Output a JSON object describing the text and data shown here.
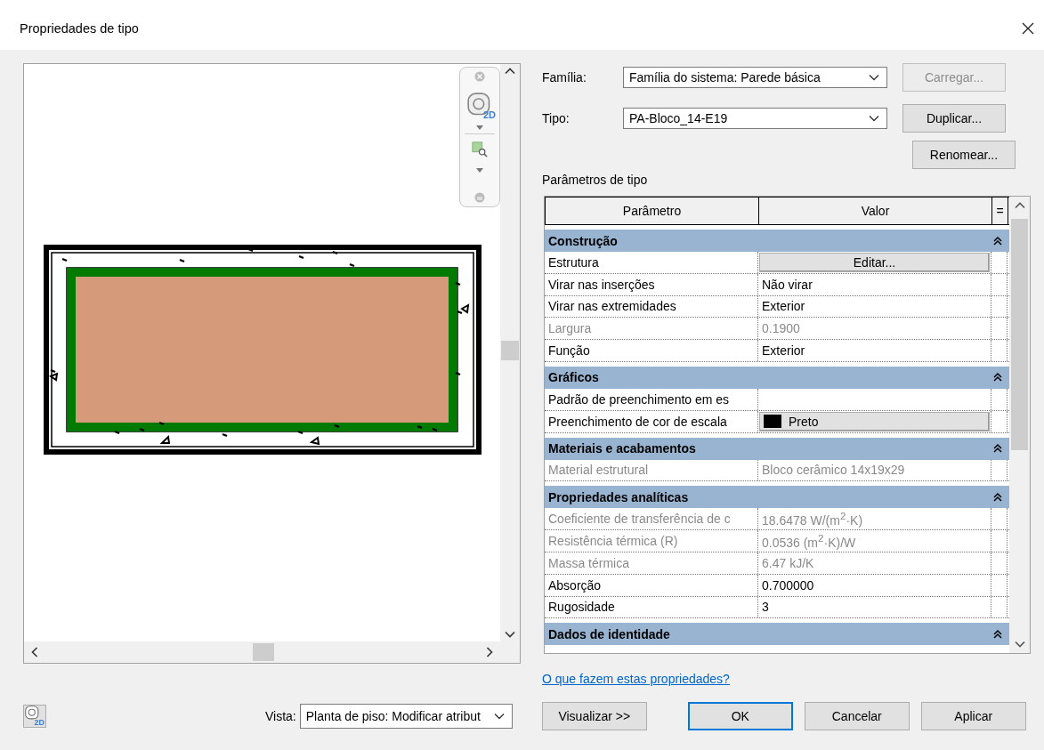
{
  "window": {
    "title": "Propriedades de tipo"
  },
  "navigation": {
    "wheel_badge": "2D"
  },
  "family": {
    "label": "Família:",
    "value": "Família do sistema: Parede básica"
  },
  "type": {
    "label": "Tipo:",
    "value": "PA-Bloco_14-E19"
  },
  "side_buttons": [
    {
      "label": "Carregar...",
      "disabled": true
    },
    {
      "label": "Duplicar...",
      "disabled": false
    },
    {
      "label": "Renomear...",
      "disabled": false
    }
  ],
  "parameters": {
    "title": "Parâmetros de tipo",
    "columns": [
      "Parâmetro",
      "Valor",
      "="
    ],
    "rows": [
      {
        "kind": "group",
        "label": "Construção",
        "expanded": true
      },
      {
        "kind": "button",
        "name": "Estrutura",
        "value": "Editar...",
        "disabled": false
      },
      {
        "kind": "text",
        "name": "Virar nas inserções",
        "value": "Não virar",
        "disabled": false
      },
      {
        "kind": "text",
        "name": "Virar nas extremidades",
        "value": "Exterior",
        "disabled": false
      },
      {
        "kind": "text",
        "name": "Largura",
        "value": "0.1900",
        "disabled": true
      },
      {
        "kind": "text",
        "name": "Função",
        "value": "Exterior",
        "disabled": false
      },
      {
        "kind": "group",
        "label": "Gráficos",
        "expanded": true
      },
      {
        "kind": "text",
        "name": "Padrão de preenchimento em es",
        "disabled": false
      },
      {
        "kind": "color",
        "name": "Preenchimento de cor de escala",
        "value": "Preto",
        "color": "#000000",
        "disabled": false
      },
      {
        "kind": "group",
        "label": "Materiais e acabamentos",
        "expanded": true
      },
      {
        "kind": "text",
        "name": "Material estrutural",
        "value": "Bloco cerâmico 14x19x29",
        "disabled": true
      },
      {
        "kind": "group",
        "label": "Propriedades analíticas",
        "expanded": true
      },
      {
        "kind": "text",
        "name": "Coeficiente de transferência de c",
        "value": "18.6478 W/(m$^{2}$·K)",
        "disabled": true
      },
      {
        "kind": "text",
        "name": "Resistência térmica (R)",
        "value": "0.0536 (m$^{2}$·K)/W",
        "disabled": true
      },
      {
        "kind": "text",
        "name": "Massa térmica",
        "value": "6.47 kJ/K",
        "disabled": true
      },
      {
        "kind": "text",
        "name": "Absorção",
        "value": "0.700000",
        "disabled": false
      },
      {
        "kind": "text",
        "name": "Rugosidade",
        "value": "3",
        "disabled": false
      },
      {
        "kind": "group",
        "label": "Dados de identidade",
        "expanded": true
      }
    ]
  },
  "help_link": "O que fazem estas propriedades?",
  "footer": {
    "wheel_badge": "2D",
    "view_label": "Vista:",
    "view_value": "Planta de piso: Modificar atribut",
    "preview_button": "Visualizar >>"
  },
  "buttons": [
    {
      "label": "OK",
      "default": true
    },
    {
      "label": "Cancelar",
      "default": false
    },
    {
      "label": "Aplicar",
      "default": false
    }
  ]
}
